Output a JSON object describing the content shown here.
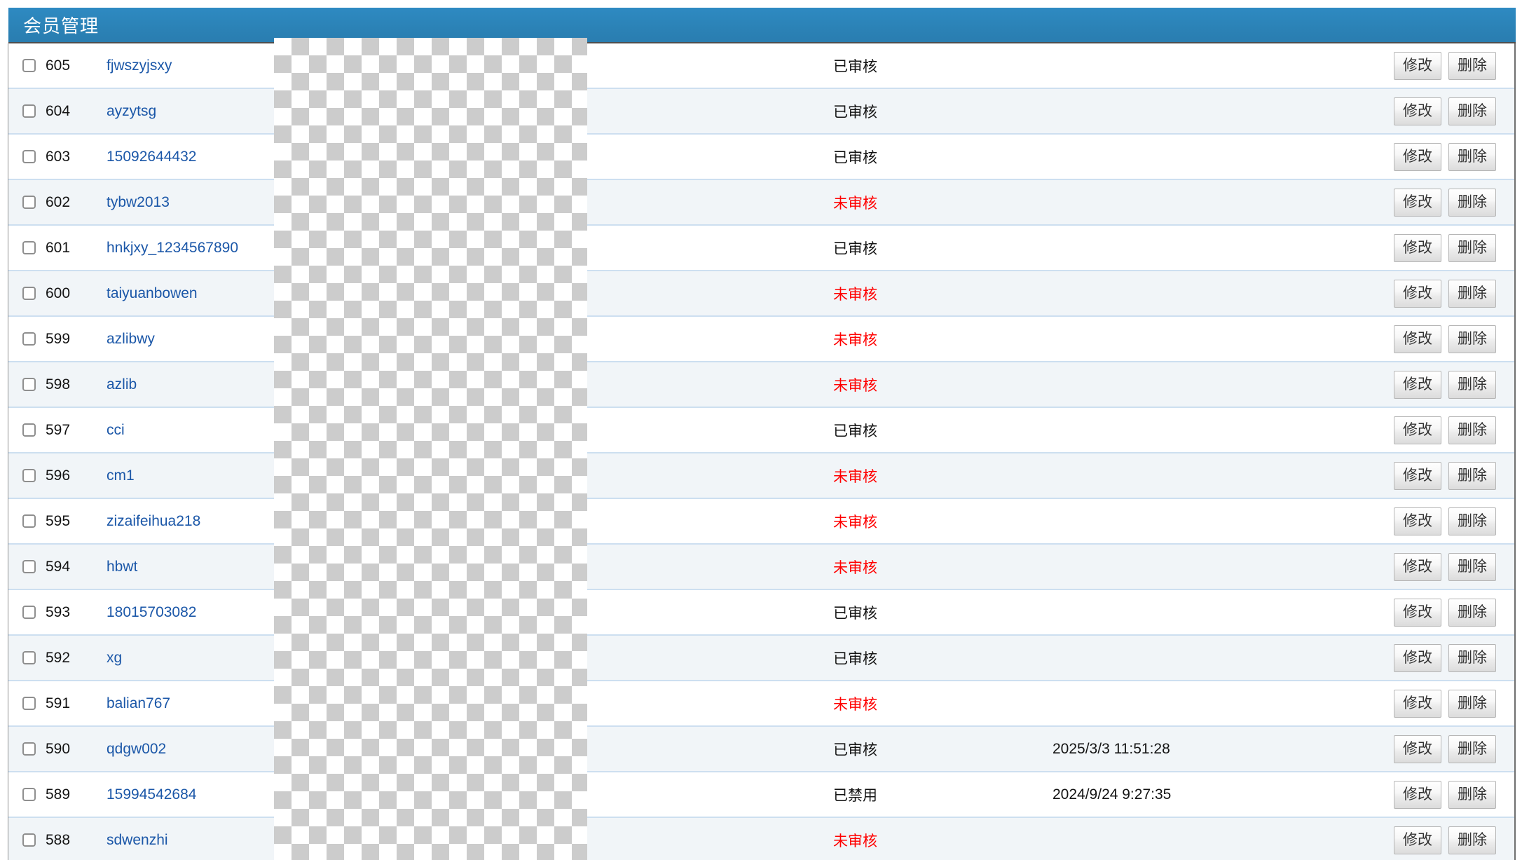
{
  "header": {
    "title": "会员管理"
  },
  "actions": {
    "modify_label": "修改",
    "delete_label": "删除"
  },
  "status_labels": {
    "approved": "已审核",
    "pending": "未审核",
    "disabled": "已禁用"
  },
  "colors": {
    "header_blue": "#2b84ba",
    "header_border": "#4e4e4e",
    "pending_red": "#ff0000",
    "link_blue": "#1b57a8",
    "row_alt_bg": "#f1f5f8",
    "row_border": "#cddff0",
    "checker_gray": "#cccccc"
  },
  "members": [
    {
      "id": "605",
      "username": "fjwszyjsxy",
      "status": "approved",
      "reg_time": ""
    },
    {
      "id": "604",
      "username": "ayzytsg",
      "status": "approved",
      "reg_time": ""
    },
    {
      "id": "603",
      "username": "15092644432",
      "status": "approved",
      "reg_time": ""
    },
    {
      "id": "602",
      "username": "tybw2013",
      "status": "pending",
      "reg_time": ""
    },
    {
      "id": "601",
      "username": "hnkjxy_1234567890",
      "status": "approved",
      "reg_time": ""
    },
    {
      "id": "600",
      "username": "taiyuanbowen",
      "status": "pending",
      "reg_time": ""
    },
    {
      "id": "599",
      "username": "azlibwy",
      "status": "pending",
      "reg_time": ""
    },
    {
      "id": "598",
      "username": "azlib",
      "status": "pending",
      "reg_time": ""
    },
    {
      "id": "597",
      "username": "cci",
      "status": "approved",
      "reg_time": ""
    },
    {
      "id": "596",
      "username": "cm1",
      "status": "pending",
      "reg_time": ""
    },
    {
      "id": "595",
      "username": "zizaifeihua218",
      "status": "pending",
      "reg_time": ""
    },
    {
      "id": "594",
      "username": "hbwt",
      "status": "pending",
      "reg_time": ""
    },
    {
      "id": "593",
      "username": "18015703082",
      "status": "approved",
      "reg_time": ""
    },
    {
      "id": "592",
      "username": "xg",
      "status": "approved",
      "reg_time": ""
    },
    {
      "id": "591",
      "username": "balian767",
      "status": "pending",
      "reg_time": ""
    },
    {
      "id": "590",
      "username": "qdgw002",
      "status": "approved",
      "reg_time": "2025/3/3 11:51:28"
    },
    {
      "id": "589",
      "username": "15994542684",
      "status": "disabled",
      "reg_time": "2024/9/24 9:27:35"
    },
    {
      "id": "588",
      "username": "sdwenzhi",
      "status": "pending",
      "reg_time": ""
    }
  ]
}
